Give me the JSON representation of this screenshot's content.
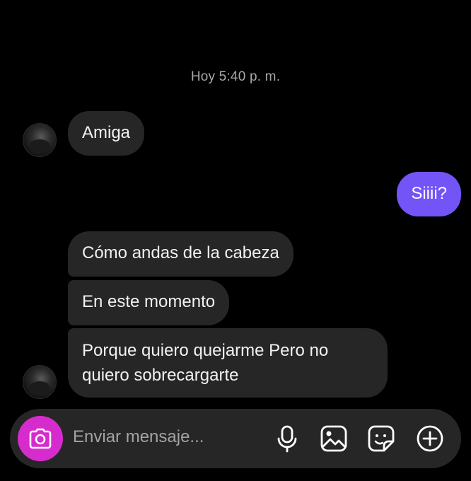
{
  "thread": {
    "timestamp": "Hoy 5:40 p. m.",
    "messages": [
      {
        "sender": "them",
        "text": "Amiga"
      },
      {
        "sender": "me",
        "text": "Siiii?"
      },
      {
        "sender": "them",
        "text": "Cómo andas de la cabeza"
      },
      {
        "sender": "them",
        "text": "En este momento"
      },
      {
        "sender": "them",
        "text": "Porque quiero quejarme Pero no quiero sobrecargarte"
      }
    ]
  },
  "composer": {
    "placeholder": "Enviar mensaje...",
    "icons": [
      "camera-icon",
      "microphone-icon",
      "image-icon",
      "sticker-icon",
      "plus-icon"
    ]
  },
  "colors": {
    "background": "#000000",
    "received_bubble": "#262626",
    "sent_bubble": "#7254f7",
    "camera_button": "#d62ccd",
    "timestamp_text": "#a8a8a8"
  }
}
